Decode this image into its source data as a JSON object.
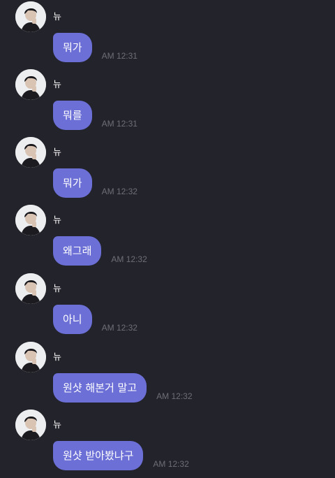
{
  "theme": {
    "background": "#23232b",
    "bubble": "#6b6fd6",
    "time_color": "#6e6e78"
  },
  "messages": [
    {
      "sender": "뉴",
      "text": "뭐가",
      "time": "AM 12:31"
    },
    {
      "sender": "뉴",
      "text": "뭐를",
      "time": "AM 12:31"
    },
    {
      "sender": "뉴",
      "text": "뭐가",
      "time": "AM 12:32"
    },
    {
      "sender": "뉴",
      "text": "왜그래",
      "time": "AM 12:32"
    },
    {
      "sender": "뉴",
      "text": "아니",
      "time": "AM 12:32"
    },
    {
      "sender": "뉴",
      "text": "원샷 해본거 말고",
      "time": "AM 12:32"
    },
    {
      "sender": "뉴",
      "text": "원샷 받아봤냐구",
      "time": "AM 12:32"
    }
  ]
}
